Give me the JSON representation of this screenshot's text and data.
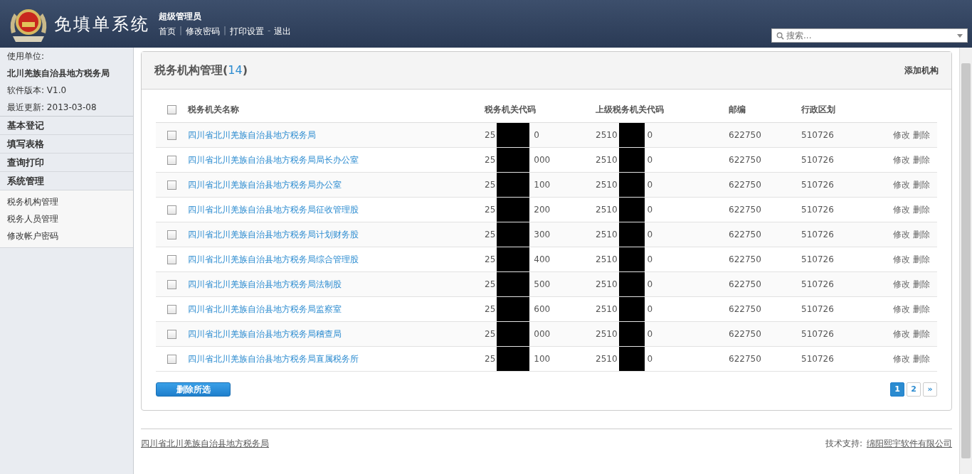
{
  "header": {
    "title": "免填单系统",
    "user": "超级管理员",
    "nav": [
      "首页",
      "修改密码",
      "打印设置",
      "退出"
    ],
    "separators": [
      "|",
      "|",
      "-"
    ],
    "search": {
      "placeholder": "搜索..."
    }
  },
  "sidebar": {
    "info": [
      {
        "text": "使用单位:",
        "bold": false
      },
      {
        "text": "北川羌族自治县地方税务局",
        "bold": true
      },
      {
        "text": "软件版本: V1.0",
        "bold": false
      },
      {
        "text": "最近更新: 2013-03-08",
        "bold": false
      }
    ],
    "sections": [
      {
        "label": "基本登记"
      },
      {
        "label": "填写表格"
      },
      {
        "label": "查询打印"
      },
      {
        "label": "系统管理",
        "children": [
          "税务机构管理",
          "税务人员管理",
          "修改帐户密码"
        ]
      }
    ]
  },
  "panel": {
    "title": "税务机构管理",
    "count": "14",
    "brackets": [
      "(",
      ")"
    ],
    "action": "添加机构",
    "table": {
      "select_all": {
        "checked": false
      },
      "columns": [
        "税务机关名称",
        "税务机关代码",
        "上级税务机关代码",
        "邮编",
        "行政区划"
      ],
      "rows": [
        {
          "checked": false,
          "name": "四川省北川羌族自治县地方税务局",
          "code": [
            "25",
            "0"
          ],
          "parent": [
            "2510",
            "0"
          ],
          "zip": "622750",
          "region": "510726",
          "actions": [
            "修改",
            "删除"
          ]
        },
        {
          "checked": false,
          "name": "四川省北川羌族自治县地方税务局局长办公室",
          "code": [
            "25",
            "000"
          ],
          "parent": [
            "2510",
            "0"
          ],
          "zip": "622750",
          "region": "510726",
          "actions": [
            "修改",
            "删除"
          ]
        },
        {
          "checked": false,
          "name": "四川省北川羌族自治县地方税务局办公室",
          "code": [
            "25",
            "100"
          ],
          "parent": [
            "2510",
            "0"
          ],
          "zip": "622750",
          "region": "510726",
          "actions": [
            "修改",
            "删除"
          ]
        },
        {
          "checked": false,
          "name": "四川省北川羌族自治县地方税务局征收管理股",
          "code": [
            "25",
            "200"
          ],
          "parent": [
            "2510",
            "0"
          ],
          "zip": "622750",
          "region": "510726",
          "actions": [
            "修改",
            "删除"
          ]
        },
        {
          "checked": false,
          "name": "四川省北川羌族自治县地方税务局计划财务股",
          "code": [
            "25",
            "300"
          ],
          "parent": [
            "2510",
            "0"
          ],
          "zip": "622750",
          "region": "510726",
          "actions": [
            "修改",
            "删除"
          ]
        },
        {
          "checked": false,
          "name": "四川省北川羌族自治县地方税务局综合管理股",
          "code": [
            "25",
            "400"
          ],
          "parent": [
            "2510",
            "0"
          ],
          "zip": "622750",
          "region": "510726",
          "actions": [
            "修改",
            "删除"
          ]
        },
        {
          "checked": false,
          "name": "四川省北川羌族自治县地方税务局法制股",
          "code": [
            "25",
            "500"
          ],
          "parent": [
            "2510",
            "0"
          ],
          "zip": "622750",
          "region": "510726",
          "actions": [
            "修改",
            "删除"
          ]
        },
        {
          "checked": false,
          "name": "四川省北川羌族自治县地方税务局监察室",
          "code": [
            "25",
            "600"
          ],
          "parent": [
            "2510",
            "0"
          ],
          "zip": "622750",
          "region": "510726",
          "actions": [
            "修改",
            "删除"
          ]
        },
        {
          "checked": false,
          "name": "四川省北川羌族自治县地方税务局稽查局",
          "code": [
            "25",
            "000"
          ],
          "parent": [
            "2510",
            "0"
          ],
          "zip": "622750",
          "region": "510726",
          "actions": [
            "修改",
            "删除"
          ]
        },
        {
          "checked": false,
          "name": "四川省北川羌族自治县地方税务局直属税务所",
          "code": [
            "25",
            "100"
          ],
          "parent": [
            "2510",
            "0"
          ],
          "zip": "622750",
          "region": "510726",
          "actions": [
            "修改",
            "删除"
          ]
        }
      ]
    },
    "delete_button": "删除所选",
    "pagination": [
      {
        "label": "1",
        "selected": true
      },
      {
        "label": "2",
        "selected": false
      },
      {
        "label": "»",
        "selected": false
      }
    ]
  },
  "footer": {
    "left": "四川省北川羌族自治县地方税务局",
    "support_label": "技术支持:",
    "support_link": "绵阳熙宇软件有限公司"
  }
}
